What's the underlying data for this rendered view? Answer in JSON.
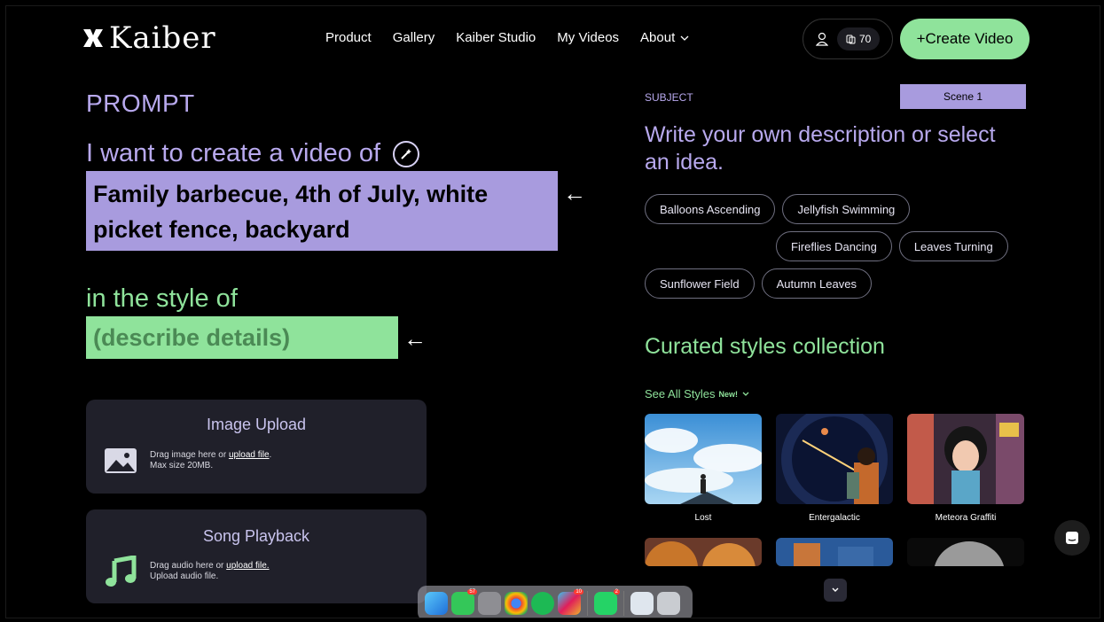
{
  "header": {
    "logo_text": "Kaiber",
    "nav": [
      "Product",
      "Gallery",
      "Kaiber Studio",
      "My Videos",
      "About"
    ],
    "credits": "70",
    "create_button": "+Create Video"
  },
  "prompt": {
    "title": "PROMPT",
    "intro": "I want to create a video of",
    "subject_text": "Family barbecue, 4th of July, white picket fence, backyard",
    "style_intro": "in the style of",
    "style_placeholder": "(describe details)"
  },
  "image_upload": {
    "title": "Image Upload",
    "desc_prefix": "Drag image here or ",
    "link": "upload file",
    "desc_suffix": ".",
    "max": "Max size 20MB."
  },
  "song_playback": {
    "title": "Song Playback",
    "desc_prefix": "Drag audio here or ",
    "link": "upload file.",
    "desc_suffix": "",
    "sub": "Upload audio file."
  },
  "subject_panel": {
    "label": "SUBJECT",
    "scene": "Scene 1",
    "heading": "Write your own description or select an idea.",
    "chips": [
      "Balloons Ascending",
      "Jellyfish Swimming",
      "Fireflies Dancing",
      "Leaves Turning",
      "Sunflower Field",
      "Autumn Leaves"
    ]
  },
  "styles": {
    "heading": "Curated styles collection",
    "see_all": "See All Styles",
    "new_badge": "New!",
    "tiles": [
      "Lost",
      "Entergalactic",
      "Meteora Graffiti"
    ]
  },
  "dock": {
    "badges": [
      "57",
      "10",
      "2"
    ]
  },
  "colors": {
    "purple": "#a89bde",
    "green": "#8fe39b",
    "card_bg": "#20202a"
  }
}
